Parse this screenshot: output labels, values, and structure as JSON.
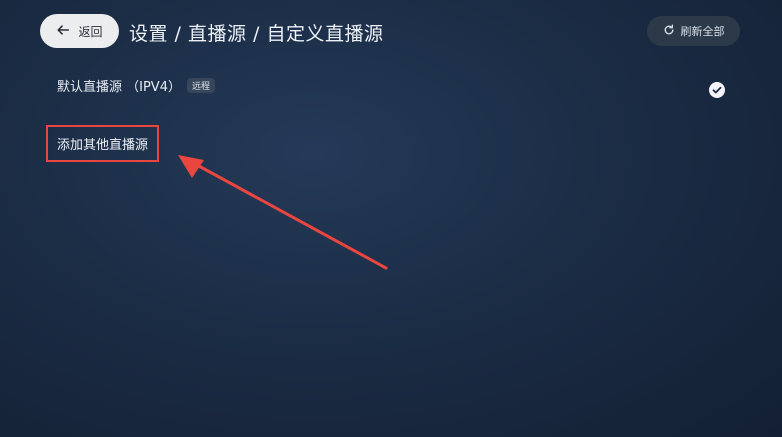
{
  "header": {
    "back_label": "返回",
    "breadcrumb": "设置 / 直播源 / 自定义直播源",
    "refresh_label": "刷新全部"
  },
  "sources": {
    "default": {
      "label": "默认直播源 （IPV4）",
      "badge": "远程",
      "selected": true
    },
    "add_label": "添加其他直播源"
  },
  "annotation": {
    "color": "#e8463f"
  }
}
